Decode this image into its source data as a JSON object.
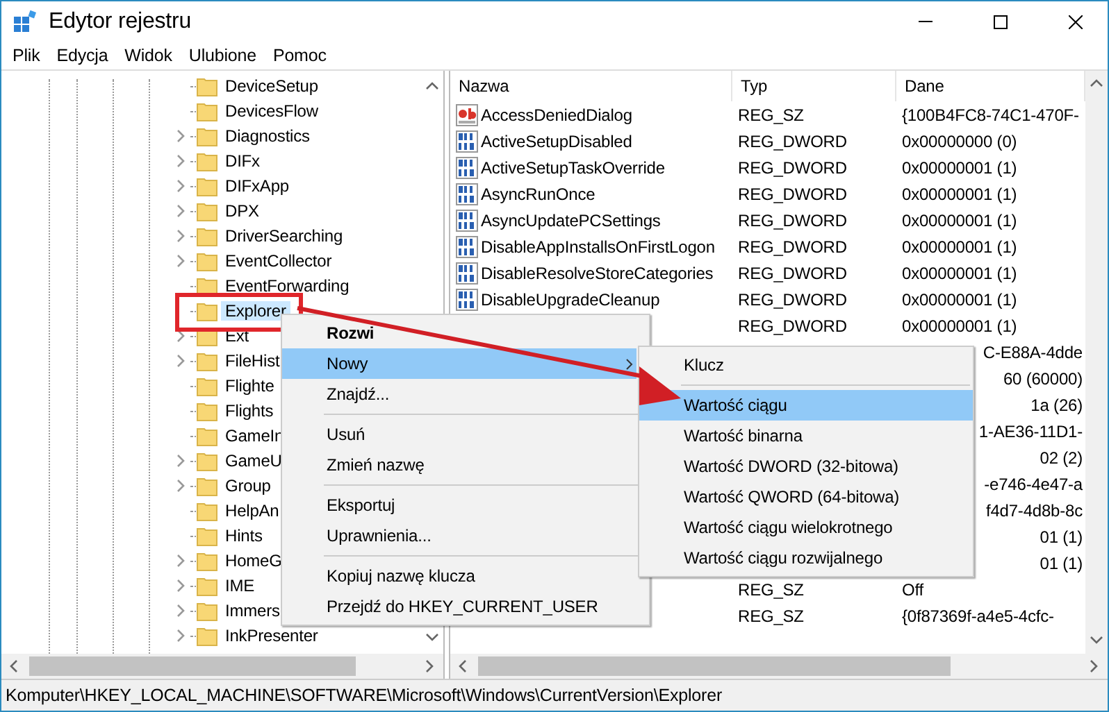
{
  "window": {
    "title": "Edytor rejestru"
  },
  "menu": [
    "Plik",
    "Edycja",
    "Widok",
    "Ulubione",
    "Pomoc"
  ],
  "tree": [
    {
      "label": "DeviceSetup",
      "expandable": false,
      "selected": false
    },
    {
      "label": "DevicesFlow",
      "expandable": false,
      "selected": false
    },
    {
      "label": "Diagnostics",
      "expandable": true,
      "selected": false
    },
    {
      "label": "DIFx",
      "expandable": true,
      "selected": false
    },
    {
      "label": "DIFxApp",
      "expandable": true,
      "selected": false
    },
    {
      "label": "DPX",
      "expandable": true,
      "selected": false
    },
    {
      "label": "DriverSearching",
      "expandable": true,
      "selected": false
    },
    {
      "label": "EventCollector",
      "expandable": true,
      "selected": false
    },
    {
      "label": "EventForwarding",
      "expandable": false,
      "selected": false
    },
    {
      "label": "Explorer",
      "expandable": false,
      "selected": true
    },
    {
      "label": "Ext",
      "expandable": true,
      "selected": false
    },
    {
      "label": "FileHist",
      "expandable": true,
      "selected": false
    },
    {
      "label": "Flighte",
      "expandable": false,
      "selected": false
    },
    {
      "label": "Flights",
      "expandable": false,
      "selected": false
    },
    {
      "label": "GameIn",
      "expandable": false,
      "selected": false
    },
    {
      "label": "GameU",
      "expandable": true,
      "selected": false
    },
    {
      "label": "Group",
      "expandable": true,
      "selected": false
    },
    {
      "label": "HelpAn",
      "expandable": false,
      "selected": false
    },
    {
      "label": "Hints",
      "expandable": false,
      "selected": false
    },
    {
      "label": "HomeG",
      "expandable": true,
      "selected": false
    },
    {
      "label": "IME",
      "expandable": true,
      "selected": false
    },
    {
      "label": "Immers",
      "expandable": true,
      "selected": false
    },
    {
      "label": "InkPresenter",
      "expandable": true,
      "selected": false
    }
  ],
  "table": {
    "columns": [
      "Nazwa",
      "Typ",
      "Dane"
    ],
    "rows": [
      {
        "kind": "sz",
        "name": "AccessDeniedDialog",
        "type": "REG_SZ",
        "data": "{100B4FC8-74C1-470F-"
      },
      {
        "kind": "dword",
        "name": "ActiveSetupDisabled",
        "type": "REG_DWORD",
        "data": "0x00000000 (0)"
      },
      {
        "kind": "dword",
        "name": "ActiveSetupTaskOverride",
        "type": "REG_DWORD",
        "data": "0x00000001 (1)"
      },
      {
        "kind": "dword",
        "name": "AsyncRunOnce",
        "type": "REG_DWORD",
        "data": "0x00000001 (1)"
      },
      {
        "kind": "dword",
        "name": "AsyncUpdatePCSettings",
        "type": "REG_DWORD",
        "data": "0x00000001 (1)"
      },
      {
        "kind": "dword",
        "name": "DisableAppInstallsOnFirstLogon",
        "type": "REG_DWORD",
        "data": "0x00000001 (1)"
      },
      {
        "kind": "dword",
        "name": "DisableResolveStoreCategories",
        "type": "REG_DWORD",
        "data": "0x00000001 (1)"
      },
      {
        "kind": "dword",
        "name": "DisableUpgradeCleanup",
        "type": "REG_DWORD",
        "data": "0x00000001 (1)"
      },
      {
        "kind": "covered",
        "type": "REG_DWORD",
        "data": "0x00000001 (1)"
      },
      {
        "kind": "covered",
        "data": "C-E88A-4dde"
      },
      {
        "kind": "covered",
        "data": "60 (60000)"
      },
      {
        "kind": "covered",
        "data": "1a (26)"
      },
      {
        "kind": "covered",
        "data": "1-AE36-11D1-"
      },
      {
        "kind": "covered",
        "data": "02 (2)"
      },
      {
        "kind": "covered",
        "data": "-e746-4e47-a"
      },
      {
        "kind": "covered",
        "data": "f4d7-4d8b-8c"
      },
      {
        "kind": "covered",
        "data": "01 (1)"
      },
      {
        "kind": "covered",
        "data": "01 (1)"
      },
      {
        "kind": "covered",
        "type": "REG_SZ",
        "data": "Off"
      },
      {
        "kind": "covered",
        "type": "REG_SZ",
        "data": "{0f87369f-a4e5-4cfc-"
      }
    ]
  },
  "context_menu": [
    {
      "kind": "item",
      "label": "Rozwi",
      "bold": true,
      "selected": false
    },
    {
      "kind": "submenu",
      "label": "Nowy",
      "bold": false,
      "selected": true
    },
    {
      "kind": "item",
      "label": "Znajdź...",
      "bold": false,
      "selected": false
    },
    {
      "kind": "separator"
    },
    {
      "kind": "item",
      "label": "Usuń",
      "bold": false,
      "selected": false
    },
    {
      "kind": "item",
      "label": "Zmień nazwę",
      "bold": false,
      "selected": false
    },
    {
      "kind": "separator"
    },
    {
      "kind": "item",
      "label": "Eksportuj",
      "bold": false,
      "selected": false
    },
    {
      "kind": "item",
      "label": "Uprawnienia...",
      "bold": false,
      "selected": false
    },
    {
      "kind": "separator"
    },
    {
      "kind": "item",
      "label": "Kopiuj nazwę klucza",
      "bold": false,
      "selected": false
    },
    {
      "kind": "item",
      "label": "Przejdź do HKEY_CURRENT_USER",
      "bold": false,
      "selected": false
    }
  ],
  "submenu": [
    {
      "kind": "item",
      "label": "Klucz",
      "selected": false
    },
    {
      "kind": "separator"
    },
    {
      "kind": "item",
      "label": "Wartość ciągu",
      "selected": true
    },
    {
      "kind": "item",
      "label": "Wartość binarna",
      "selected": false
    },
    {
      "kind": "item",
      "label": "Wartość DWORD (32-bitowa)",
      "selected": false
    },
    {
      "kind": "item",
      "label": "Wartość QWORD (64-bitowa)",
      "selected": false
    },
    {
      "kind": "item",
      "label": "Wartość ciągu wielokrotnego",
      "selected": false
    },
    {
      "kind": "item",
      "label": "Wartość ciągu rozwijalnego",
      "selected": false
    }
  ],
  "status_bar": "Komputer\\HKEY_LOCAL_MACHINE\\SOFTWARE\\Microsoft\\Windows\\CurrentVersion\\Explorer"
}
